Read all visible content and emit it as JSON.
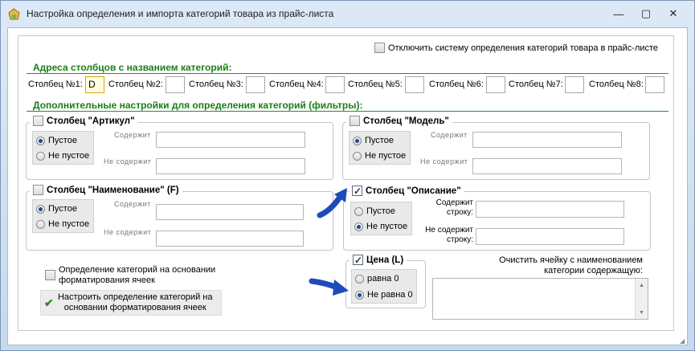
{
  "window": {
    "title": "Настройка определения и импорта категорий товара из прайс-листа",
    "minimize": "—",
    "maximize": "▢",
    "close": "✕"
  },
  "disable_system": {
    "label": "Отключить систему определения категорий товара в прайс-листе"
  },
  "columns_section": {
    "title": "Адреса столбцов с названием категорий:",
    "fields": [
      {
        "label": "Столбец №1:",
        "value": "D"
      },
      {
        "label": "Столбец №2:",
        "value": ""
      },
      {
        "label": "Столбец №3:",
        "value": ""
      },
      {
        "label": "Столбец №4:",
        "value": ""
      },
      {
        "label": "Столбец №5:",
        "value": ""
      },
      {
        "label": "Столбец №6:",
        "value": ""
      },
      {
        "label": "Столбец №7:",
        "value": ""
      },
      {
        "label": "Столбец №8:",
        "value": ""
      }
    ]
  },
  "filters_section": {
    "title": "Дополнительные настройки для определения категорий (фильтры):"
  },
  "groups": {
    "article": {
      "title": "Столбец \"Артикул\"",
      "checked": false,
      "opt_empty": "Пустое",
      "opt_notempty": "Не пустое",
      "contains": "Содержит",
      "not_contains": "Не содержит"
    },
    "model": {
      "title": "Столбец \"Модель\"",
      "checked": false,
      "opt_empty": "Пустое",
      "opt_notempty": "Не пустое",
      "contains": "Содержит",
      "not_contains": "Не содержит"
    },
    "name": {
      "title": "Столбец \"Наименование\" (F)",
      "checked": false,
      "opt_empty": "Пустое",
      "opt_notempty": "Не пустое",
      "contains": "Содержит",
      "not_contains": "Не содержит"
    },
    "description": {
      "title": "Столбец \"Описание\"",
      "checked": true,
      "opt_empty": "Пустое",
      "opt_notempty": "Не пустое",
      "contains": "Содержит строку:",
      "not_contains": "Не содержит строку:"
    },
    "price": {
      "title": "Цена (L)",
      "checked": true,
      "opt_equal": "равна 0",
      "opt_notequal": "Не равна 0"
    }
  },
  "format_cat": {
    "checkbox_label_1": "Определение категорий на основании",
    "checkbox_label_2": "форматирования ячеек",
    "button_1": "Настроить определение категорий на",
    "button_2": "основании форматирования ячеек"
  },
  "clear_cell": {
    "label_1": "Очистить ячейку с наименованием",
    "label_2": "категории содержащую:"
  }
}
